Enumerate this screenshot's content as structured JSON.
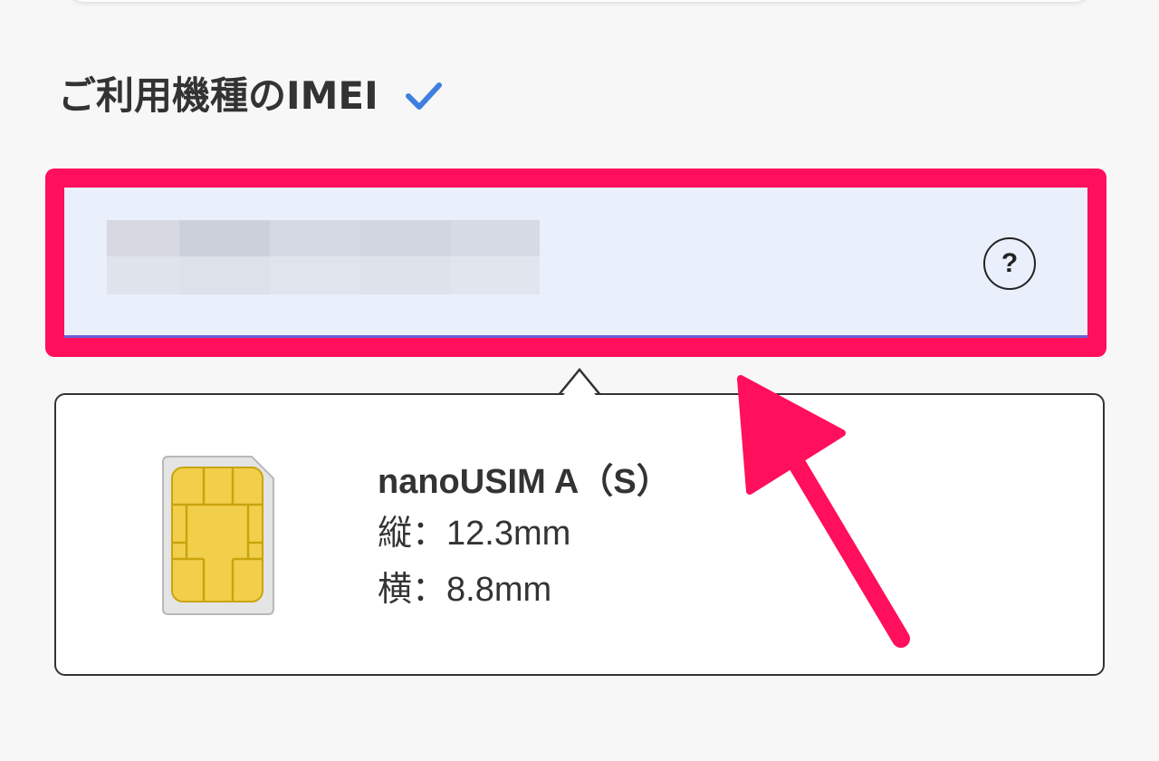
{
  "section": {
    "title": "ご利用機種のIMEI",
    "check_icon": "checkmark-icon"
  },
  "imei_field": {
    "value_redacted": true,
    "help_icon": "question-circle-icon",
    "help_label": "?"
  },
  "tooltip": {
    "sim_icon": "sim-card-icon",
    "name": "nanoUSIM A（S）",
    "height_label": "縦：12.3mm",
    "width_label": "横：8.8mm"
  },
  "colors": {
    "highlight": "#ff0f5c",
    "field_bg": "#e9effb",
    "field_underline": "#6a5fd6",
    "check": "#3f7fe0",
    "text": "#333333"
  },
  "annotation": {
    "arrow_icon": "pointer-arrow-icon"
  }
}
